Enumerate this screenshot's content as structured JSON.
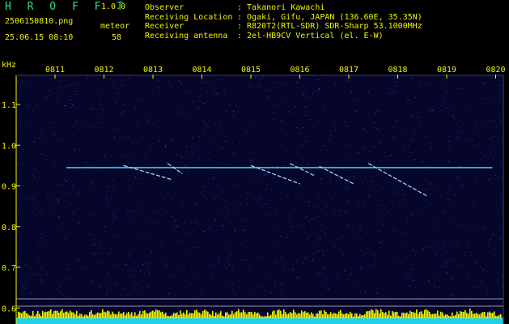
{
  "app": {
    "name": "H R O F F T",
    "version": "1.0.0"
  },
  "file": {
    "name": "2506150810.png",
    "datetime": "25.06.15 08:10"
  },
  "meteor": {
    "label": "meteor",
    "count": "58"
  },
  "station": [
    {
      "key": "Observer",
      "value": ": Takanori Kawachi"
    },
    {
      "key": "Receiving Location",
      "value": ": Ogaki, Gifu, JAPAN (136.60E, 35.35N)"
    },
    {
      "key": "Receiver",
      "value": ": R820T2(RTL-SDR) SDR-Sharp 53.1000MHz"
    },
    {
      "key": "Receiving antenna",
      "value": ": 2el-HB9CV Vertical (el. E-W)"
    }
  ],
  "colors": {
    "text": "#f2f200",
    "logo": "#2fe07a",
    "background": "#06062a",
    "carrier": "#2fd0e8",
    "trace": "#9fd0ff",
    "activity": "#f2f200",
    "baseline": "#20d0e8"
  },
  "chart_data": {
    "type": "heatmap",
    "ylabel": "kHz",
    "x_ticks": [
      "0811",
      "0812",
      "0813",
      "0814",
      "0815",
      "0816",
      "0817",
      "0818",
      "0819",
      "0820"
    ],
    "y_ticks": [
      "1.1",
      "1.0",
      "0.9",
      "0.8",
      "0.7",
      "0.6"
    ],
    "ylim": [
      0.57,
      1.2
    ],
    "carrier_khz": 0.945,
    "carrier_range": [
      "0811",
      "0820"
    ],
    "meteor_traces": [
      {
        "start": [
          "0812.4",
          0.95
        ],
        "end": [
          "0813.4",
          0.915
        ]
      },
      {
        "start": [
          "0813.3",
          0.955
        ],
        "end": [
          "0813.6",
          0.93
        ]
      },
      {
        "start": [
          "0815.0",
          0.95
        ],
        "end": [
          "0816.0",
          0.905
        ]
      },
      {
        "start": [
          "0815.8",
          0.955
        ],
        "end": [
          "0816.3",
          0.925
        ]
      },
      {
        "start": [
          "0816.4",
          0.948
        ],
        "end": [
          "0817.1",
          0.905
        ]
      },
      {
        "start": [
          "0817.4",
          0.955
        ],
        "end": [
          "0818.6",
          0.875
        ]
      }
    ],
    "grid": false
  }
}
